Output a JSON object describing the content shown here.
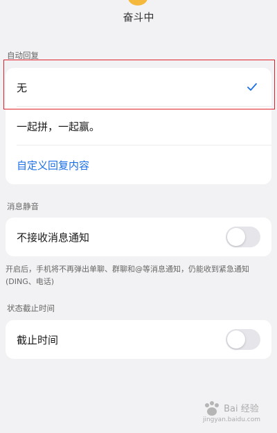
{
  "header": {
    "status_title": "奋斗中"
  },
  "auto_reply": {
    "section_label": "自动回复",
    "options": [
      {
        "label": "无",
        "selected": true
      },
      {
        "label": "一起拼，一起赢。",
        "selected": false
      }
    ],
    "custom_link": "自定义回复内容"
  },
  "mute": {
    "section_label": "消息静音",
    "toggle_label": "不接收消息通知",
    "toggle_on": false,
    "note": "开启后，手机将不再弹出单聊、群聊和@等消息通知，仍能收到紧急通知(DING、电话)"
  },
  "expiry": {
    "section_label": "状态截止时间",
    "toggle_label": "截止时间",
    "toggle_on": false
  },
  "watermark": {
    "brand": "Bai 经验",
    "site": "jingyan.baidu.com"
  },
  "colors": {
    "accent": "#1a6fe8",
    "highlight": "#e0202a",
    "toggle_off": "#e5e5ea"
  }
}
